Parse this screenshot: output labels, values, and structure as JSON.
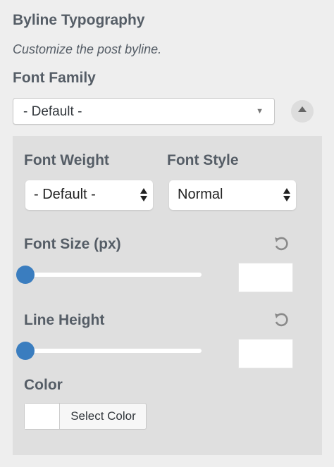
{
  "section": {
    "title": "Byline Typography",
    "description": "Customize the post byline."
  },
  "font_family": {
    "label": "Font Family",
    "value": "- Default -"
  },
  "font_weight": {
    "label": "Font Weight",
    "value": "- Default -"
  },
  "font_style": {
    "label": "Font Style",
    "value": "Normal"
  },
  "font_size": {
    "label": "Font Size (px)",
    "slider_fraction": 0.0,
    "value": ""
  },
  "line_height": {
    "label": "Line Height",
    "slider_fraction": 0.0,
    "value": ""
  },
  "color": {
    "label": "Color",
    "button_label": "Select Color",
    "swatch": "#ffffff"
  },
  "colors": {
    "accent": "#3a7dbf",
    "panel_bg": "#dfdfdf"
  },
  "icons": {
    "collapse": "chevron-up-icon",
    "reset": "undo-icon"
  }
}
